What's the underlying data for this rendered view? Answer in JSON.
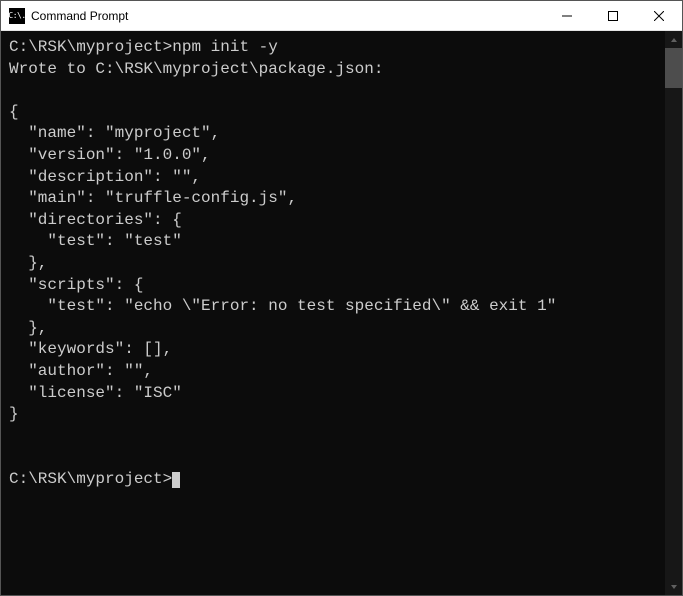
{
  "window": {
    "title": "Command Prompt",
    "icon_glyph": "C:\\."
  },
  "terminal": {
    "line1_prompt": "C:\\RSK\\myproject>",
    "line1_cmd": "npm init -y",
    "line2": "Wrote to C:\\RSK\\myproject\\package.json:",
    "blank": "",
    "json_l1": "{",
    "json_l2": "  \"name\": \"myproject\",",
    "json_l3": "  \"version\": \"1.0.0\",",
    "json_l4": "  \"description\": \"\",",
    "json_l5": "  \"main\": \"truffle-config.js\",",
    "json_l6": "  \"directories\": {",
    "json_l7": "    \"test\": \"test\"",
    "json_l8": "  },",
    "json_l9": "  \"scripts\": {",
    "json_l10": "    \"test\": \"echo \\\"Error: no test specified\\\" && exit 1\"",
    "json_l11": "  },",
    "json_l12": "  \"keywords\": [],",
    "json_l13": "  \"author\": \"\",",
    "json_l14": "  \"license\": \"ISC\"",
    "json_l15": "}",
    "final_prompt": "C:\\RSK\\myproject>"
  }
}
